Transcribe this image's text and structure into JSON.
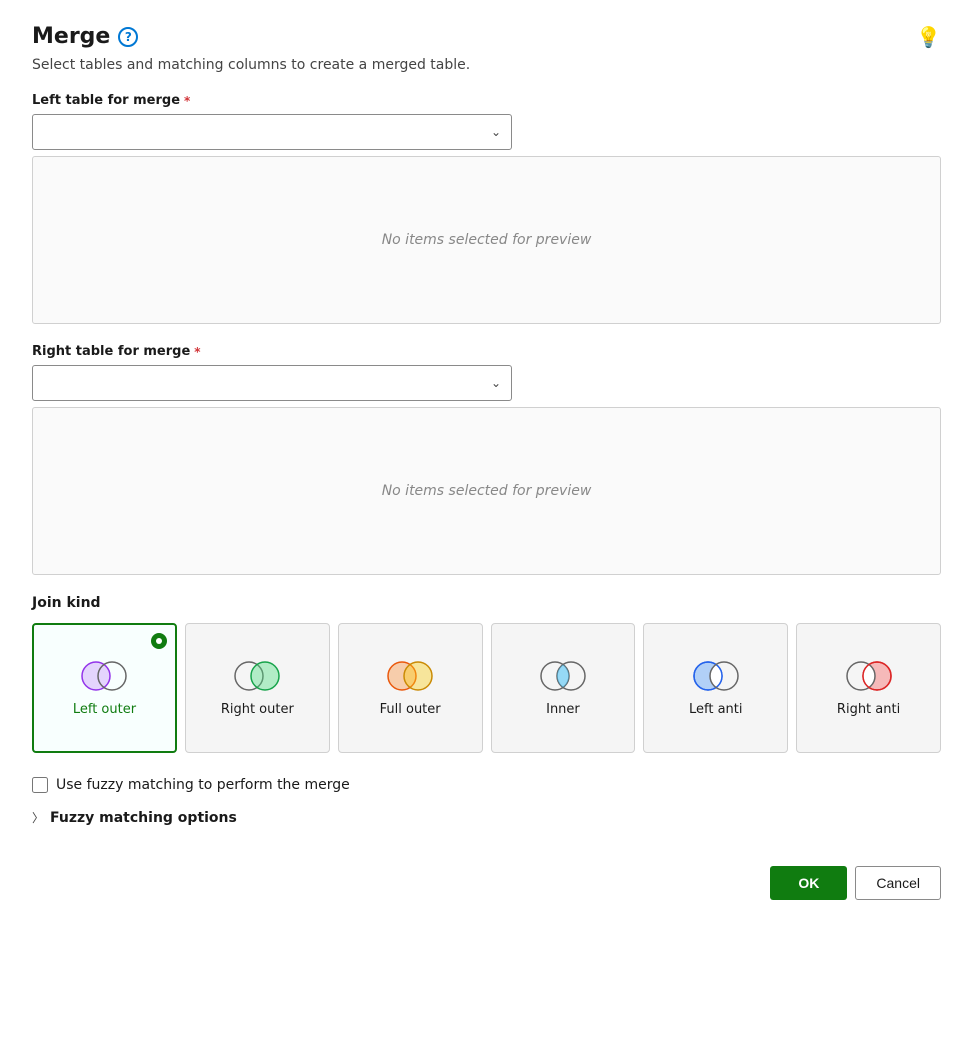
{
  "header": {
    "title": "Merge",
    "subtitle": "Select tables and matching columns to create a merged table.",
    "help_icon_label": "?",
    "lightbulb_icon": "💡"
  },
  "left_table": {
    "label": "Left table for merge",
    "required": true,
    "placeholder": "",
    "preview_empty": "No items selected for preview"
  },
  "right_table": {
    "label": "Right table for merge",
    "required": true,
    "placeholder": "",
    "preview_empty": "No items selected for preview"
  },
  "join_kind": {
    "label": "Join kind",
    "options": [
      {
        "id": "left-outer",
        "label": "Left outer",
        "selected": true
      },
      {
        "id": "right-outer",
        "label": "Right outer",
        "selected": false
      },
      {
        "id": "full-outer",
        "label": "Full outer",
        "selected": false
      },
      {
        "id": "inner",
        "label": "Inner",
        "selected": false
      },
      {
        "id": "left-anti",
        "label": "Left anti",
        "selected": false
      },
      {
        "id": "right-anti",
        "label": "Right anti",
        "selected": false
      }
    ]
  },
  "fuzzy_matching": {
    "checkbox_label": "Use fuzzy matching to perform the merge",
    "options_label": "Fuzzy matching options"
  },
  "footer": {
    "ok_label": "OK",
    "cancel_label": "Cancel"
  }
}
